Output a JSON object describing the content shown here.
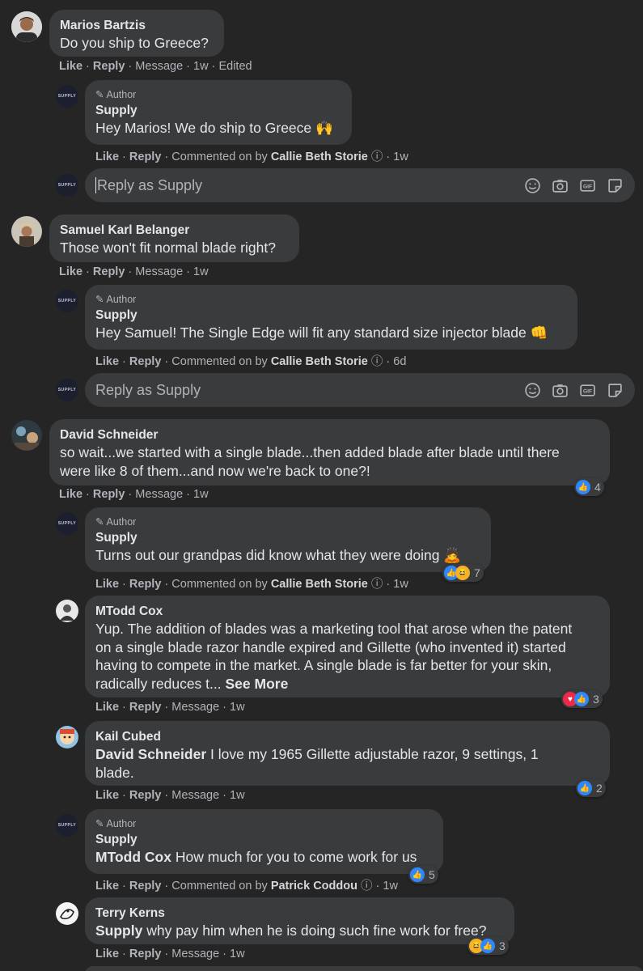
{
  "composer": {
    "placeholder": "Reply as Supply"
  },
  "labels": {
    "like": "Like",
    "reply": "Reply",
    "message": "Message",
    "edited": "Edited",
    "commented_on_by": "Commented on by",
    "author": "Author",
    "see_more": "See More"
  },
  "comments": [
    {
      "name": "Marios Bartzis",
      "text": "Do you ship to Greece?",
      "time": "1w"
    },
    {
      "name": "Supply",
      "text": "Hey Marios! We do ship to Greece 🙌",
      "by": "Callie Beth Storie",
      "time": "1w"
    },
    {
      "name": "Samuel Karl Belanger",
      "text": "Those won't fit normal blade right?",
      "time": "1w"
    },
    {
      "name": "Supply",
      "text": "Hey Samuel! The Single Edge will fit any standard size injector blade 👊",
      "by": "Callie Beth Storie",
      "time": "6d"
    },
    {
      "name": "David Schneider",
      "text_l1": "so wait...we started with a single blade...then added blade after blade until there",
      "text_l2": "were like 8 of them...and now we're back to one?!",
      "time": "1w",
      "reactions": "4"
    },
    {
      "name": "Supply",
      "text": "Turns out our grandpas did know what they were doing 🙇",
      "by": "Callie Beth Storie",
      "time": "1w",
      "reactions": "7"
    },
    {
      "name": "MTodd Cox",
      "l1": "Yup. The addition of blades was a marketing tool that arose when the patent",
      "l2": "on a single blade razor handle expired and Gillette (who invented it) started",
      "l3": "having to compete in the market. A single blade is far better for your skin,",
      "l4": "radically reduces t...",
      "time": "1w",
      "reactions": "3"
    },
    {
      "name": "Kail Cubed",
      "mention": "David Schneider",
      "text_l1": "I love my 1965 Gillette adjustable razor, 9 settings, 1",
      "text_l2": "blade.",
      "time": "1w",
      "reactions": "2"
    },
    {
      "name": "Supply",
      "mention": "MTodd Cox",
      "text": "How much for you to come work for us",
      "by": "Patrick Coddou",
      "time": "1w",
      "reactions": "5"
    },
    {
      "name": "Terry Kerns",
      "mention": "Supply",
      "text": "why pay him when he is doing such fine work for free?",
      "time": "1w",
      "reactions": "3"
    }
  ],
  "supply_logo": "SUPPLY",
  "colors": {
    "background": "#252526",
    "bubble": "#3a3b3c",
    "like_blue": "#2d88ff",
    "love_red": "#f0284a",
    "haha_yellow": "#f7b125"
  }
}
